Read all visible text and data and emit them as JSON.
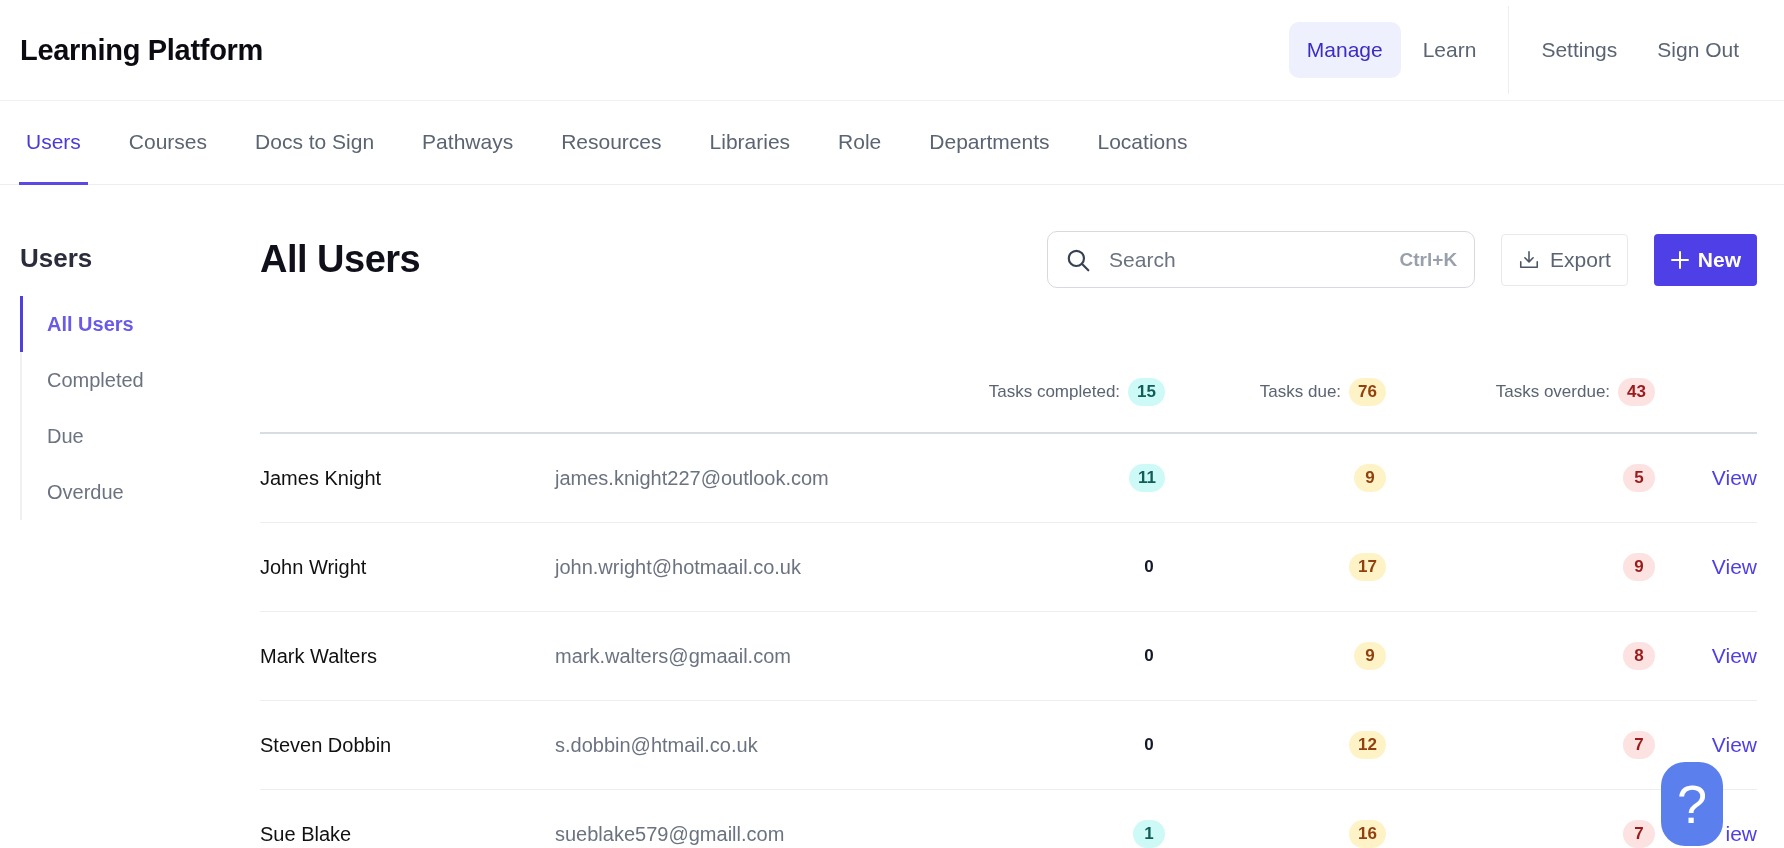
{
  "app_title": "Learning Platform",
  "top_nav": [
    {
      "label": "Manage",
      "selected": true
    },
    {
      "label": "Learn",
      "selected": false
    },
    {
      "label": "Settings",
      "selected": false
    },
    {
      "label": "Sign Out",
      "selected": false
    }
  ],
  "tabs": [
    {
      "label": "Users",
      "selected": true
    },
    {
      "label": "Courses",
      "selected": false
    },
    {
      "label": "Docs to Sign",
      "selected": false
    },
    {
      "label": "Pathways",
      "selected": false
    },
    {
      "label": "Resources",
      "selected": false
    },
    {
      "label": "Libraries",
      "selected": false
    },
    {
      "label": "Role",
      "selected": false
    },
    {
      "label": "Departments",
      "selected": false
    },
    {
      "label": "Locations",
      "selected": false
    }
  ],
  "sidebar": {
    "title": "Users",
    "items": [
      {
        "label": "All Users",
        "selected": true
      },
      {
        "label": "Completed",
        "selected": false
      },
      {
        "label": "Due",
        "selected": false
      },
      {
        "label": "Overdue",
        "selected": false
      }
    ]
  },
  "page_title": "All Users",
  "search": {
    "placeholder": "Search",
    "shortcut": "Ctrl+K"
  },
  "export_button": "Export",
  "new_button": "New",
  "stats": [
    {
      "kind": "completed",
      "label": "Tasks completed:",
      "value": "15"
    },
    {
      "kind": "due",
      "label": "Tasks due:",
      "value": "76"
    },
    {
      "kind": "overdue",
      "label": "Tasks overdue:",
      "value": "43"
    }
  ],
  "rows": [
    {
      "name": "James Knight",
      "email": "james.knight227@outlook.com",
      "counts": [
        {
          "kind": "completed",
          "value": "11",
          "badge": true
        },
        {
          "kind": "due",
          "value": "9",
          "badge": true
        },
        {
          "kind": "overdue",
          "value": "5",
          "badge": true
        }
      ],
      "action": "View"
    },
    {
      "name": "John Wright",
      "email": "john.wright@hotmaail.co.uk",
      "counts": [
        {
          "kind": "completed",
          "value": "0",
          "badge": false
        },
        {
          "kind": "due",
          "value": "17",
          "badge": true
        },
        {
          "kind": "overdue",
          "value": "9",
          "badge": true
        }
      ],
      "action": "View"
    },
    {
      "name": "Mark Walters",
      "email": "mark.walters@gmaail.com",
      "counts": [
        {
          "kind": "completed",
          "value": "0",
          "badge": false
        },
        {
          "kind": "due",
          "value": "9",
          "badge": true
        },
        {
          "kind": "overdue",
          "value": "8",
          "badge": true
        }
      ],
      "action": "View"
    },
    {
      "name": "Steven Dobbin",
      "email": "s.dobbin@htmail.co.uk",
      "counts": [
        {
          "kind": "completed",
          "value": "0",
          "badge": false
        },
        {
          "kind": "due",
          "value": "12",
          "badge": true
        },
        {
          "kind": "overdue",
          "value": "7",
          "badge": true
        }
      ],
      "action": "View"
    },
    {
      "name": "Sue Blake",
      "email": "sueblake579@gmaill.com",
      "counts": [
        {
          "kind": "completed",
          "value": "1",
          "badge": true
        },
        {
          "kind": "due",
          "value": "16",
          "badge": true
        },
        {
          "kind": "overdue",
          "value": "7",
          "badge": true
        }
      ],
      "action": "iew"
    }
  ],
  "help_button": "?"
}
